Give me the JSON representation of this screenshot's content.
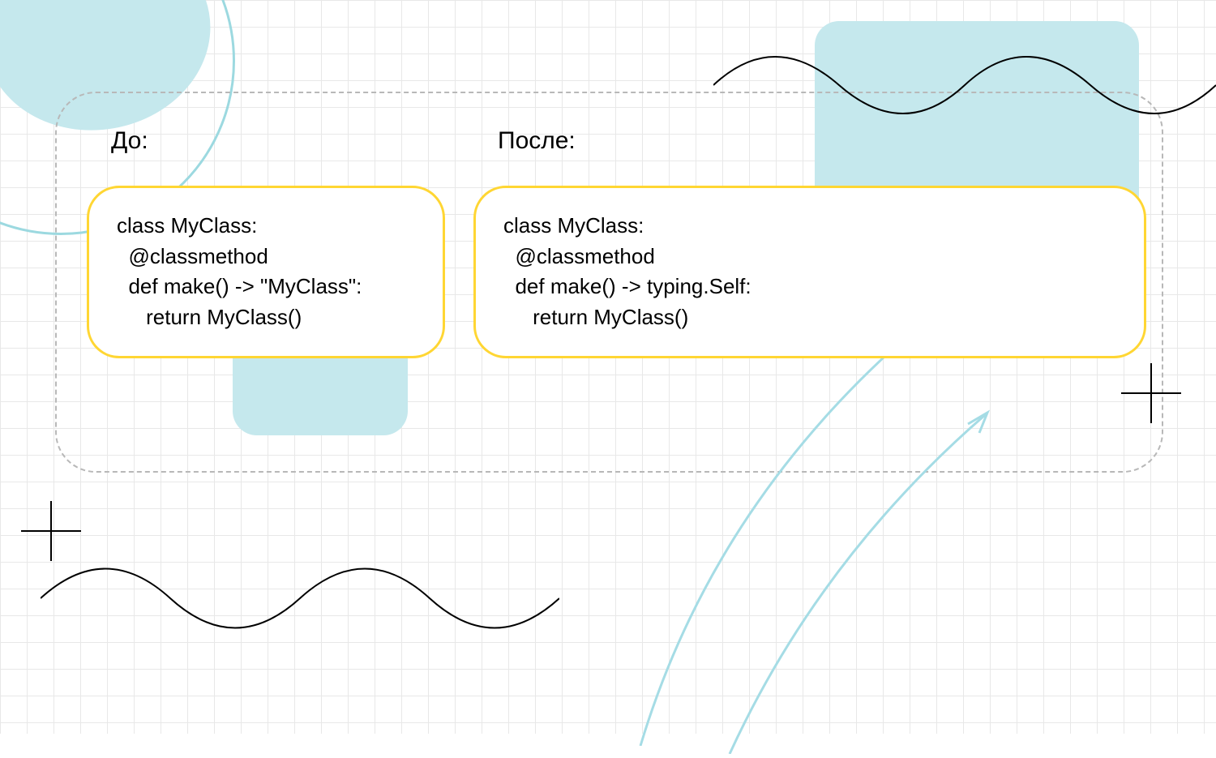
{
  "labels": {
    "before": "До:",
    "after": "После:"
  },
  "code": {
    "before": {
      "line1": "class MyClass:",
      "line2": "  @classmethod",
      "line3": "  def make() -> \"MyClass\":",
      "line4": "     return MyClass()"
    },
    "after": {
      "line1": "class MyClass:",
      "line2": "  @classmethod",
      "line3": "  def make() -> typing.Self:",
      "line4": "     return MyClass()"
    }
  },
  "colors": {
    "cardBorder": "#ffd633",
    "blueAccent": "#c5e8ed",
    "arcStroke": "#9cd9e0",
    "grid": "#e8e8e8",
    "dash": "#b8b8b8"
  }
}
